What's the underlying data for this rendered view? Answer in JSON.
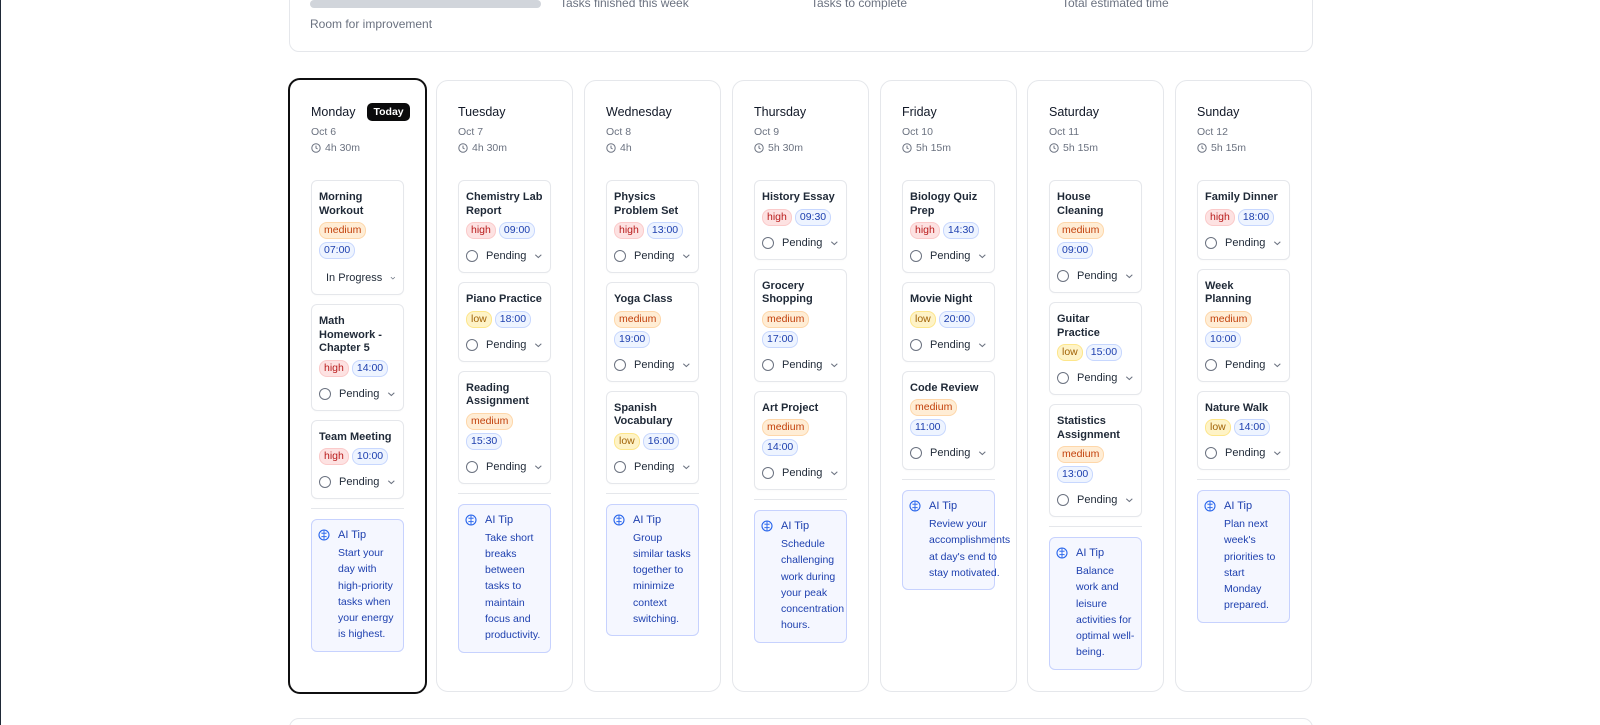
{
  "stats": {
    "progress_fraction": 0.0,
    "progress_caption": "Room for improvement",
    "labels": [
      "Tasks finished this week",
      "Tasks to complete",
      "Total estimated time"
    ]
  },
  "status_options": {
    "pending": "Pending",
    "in_progress": "In Progress"
  },
  "today_badge": "Today",
  "tip_title": "AI Tip",
  "colors": {
    "high": "#b91c1c",
    "medium": "#c2410c",
    "low": "#a16207",
    "time": "#1e40af",
    "tip": "#1e40af",
    "today_border": "#0f0f10"
  },
  "icons": {
    "clock": "clock-icon",
    "status": "status-circle-icon",
    "dropdown": "chevron-down-icon",
    "tip": "brain-icon"
  },
  "days": [
    {
      "name": "Monday",
      "date": "Oct 6",
      "duration": "4h 30m",
      "today": true,
      "tasks": [
        {
          "title": "Morning Workout",
          "priority": "medium",
          "time": "07:00",
          "status": "In Progress"
        },
        {
          "title": "Math Homework - Chapter 5",
          "priority": "high",
          "time": "14:00",
          "status": "Pending"
        },
        {
          "title": "Team Meeting",
          "priority": "high",
          "time": "10:00",
          "status": "Pending"
        }
      ],
      "tip": "Start your day with high-priority tasks when your energy is highest."
    },
    {
      "name": "Tuesday",
      "date": "Oct 7",
      "duration": "4h 30m",
      "today": false,
      "tasks": [
        {
          "title": "Chemistry Lab Report",
          "priority": "high",
          "time": "09:00",
          "status": "Pending"
        },
        {
          "title": "Piano Practice",
          "priority": "low",
          "time": "18:00",
          "status": "Pending"
        },
        {
          "title": "Reading Assignment",
          "priority": "medium",
          "time": "15:30",
          "status": "Pending"
        }
      ],
      "tip": "Take short breaks between tasks to maintain focus and productivity."
    },
    {
      "name": "Wednesday",
      "date": "Oct 8",
      "duration": "4h",
      "today": false,
      "tasks": [
        {
          "title": "Physics Problem Set",
          "priority": "high",
          "time": "13:00",
          "status": "Pending"
        },
        {
          "title": "Yoga Class",
          "priority": "medium",
          "time": "19:00",
          "status": "Pending"
        },
        {
          "title": "Spanish Vocabulary",
          "priority": "low",
          "time": "16:00",
          "status": "Pending"
        }
      ],
      "tip": "Group similar tasks together to minimize context switching."
    },
    {
      "name": "Thursday",
      "date": "Oct 9",
      "duration": "5h 30m",
      "today": false,
      "tasks": [
        {
          "title": "History Essay",
          "priority": "high",
          "time": "09:30",
          "status": "Pending"
        },
        {
          "title": "Grocery Shopping",
          "priority": "medium",
          "time": "17:00",
          "status": "Pending"
        },
        {
          "title": "Art Project",
          "priority": "medium",
          "time": "14:00",
          "status": "Pending"
        }
      ],
      "tip": "Schedule challenging work during your peak concentration hours."
    },
    {
      "name": "Friday",
      "date": "Oct 10",
      "duration": "5h 15m",
      "today": false,
      "tasks": [
        {
          "title": "Biology Quiz Prep",
          "priority": "high",
          "time": "14:30",
          "status": "Pending"
        },
        {
          "title": "Movie Night",
          "priority": "low",
          "time": "20:00",
          "status": "Pending"
        },
        {
          "title": "Code Review",
          "priority": "medium",
          "time": "11:00",
          "status": "Pending"
        }
      ],
      "tip": "Review your accomplishments at day's end to stay motivated."
    },
    {
      "name": "Saturday",
      "date": "Oct 11",
      "duration": "5h 15m",
      "today": false,
      "tasks": [
        {
          "title": "House Cleaning",
          "priority": "medium",
          "time": "09:00",
          "status": "Pending"
        },
        {
          "title": "Guitar Practice",
          "priority": "low",
          "time": "15:00",
          "status": "Pending"
        },
        {
          "title": "Statistics Assignment",
          "priority": "medium",
          "time": "13:00",
          "status": "Pending"
        }
      ],
      "tip": "Balance work and leisure activities for optimal well-being."
    },
    {
      "name": "Sunday",
      "date": "Oct 12",
      "duration": "5h 15m",
      "today": false,
      "tasks": [
        {
          "title": "Family Dinner",
          "priority": "high",
          "time": "18:00",
          "status": "Pending"
        },
        {
          "title": "Week Planning",
          "priority": "medium",
          "time": "10:00",
          "status": "Pending"
        },
        {
          "title": "Nature Walk",
          "priority": "low",
          "time": "14:00",
          "status": "Pending"
        }
      ],
      "tip": "Plan next week's priorities to start Monday prepared."
    }
  ]
}
